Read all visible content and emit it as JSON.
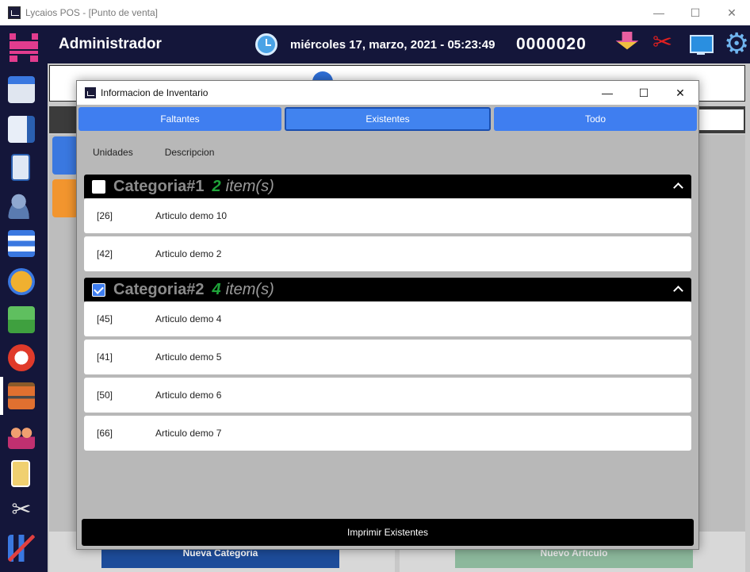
{
  "window": {
    "title": "Lycaios POS - [Punto de venta]",
    "minimize": "—",
    "maximize": "☐",
    "close": "✕"
  },
  "header": {
    "user": "Administrador",
    "datetime": "miércoles 17, marzo, 2021 - 05:23:49",
    "counter": "0000020"
  },
  "background": {
    "nueva_categoria": "Nueva Categoria",
    "nuevo_articulo": "Nuevo Articulo"
  },
  "modal": {
    "title": "Informacion de Inventario",
    "minimize": "—",
    "maximize": "☐",
    "close": "✕",
    "tabs": [
      {
        "label": "Faltantes"
      },
      {
        "label": "Existentes"
      },
      {
        "label": "Todo"
      }
    ],
    "active_tab": "Existentes",
    "columns": {
      "units": "Unidades",
      "description": "Descripcion"
    },
    "categories": [
      {
        "name": "Categoria#1",
        "count": "2",
        "items_label": "item(s)",
        "checked": false,
        "rows": [
          {
            "units": "[26]",
            "desc": "Articulo demo 10"
          },
          {
            "units": "[42]",
            "desc": "Articulo demo 2"
          }
        ]
      },
      {
        "name": "Categoria#2",
        "count": "4",
        "items_label": "item(s)",
        "checked": true,
        "rows": [
          {
            "units": "[45]",
            "desc": "Articulo demo 4"
          },
          {
            "units": "[41]",
            "desc": "Articulo demo 5"
          },
          {
            "units": "[50]",
            "desc": "Articulo demo 6"
          },
          {
            "units": "[66]",
            "desc": "Articulo demo 7"
          }
        ]
      }
    ],
    "print_button": "Imprimir Existentes"
  },
  "colors": {
    "accent_blue": "#3f7ef0",
    "header_bg": "#14163a",
    "count_green": "#1fa53a"
  }
}
